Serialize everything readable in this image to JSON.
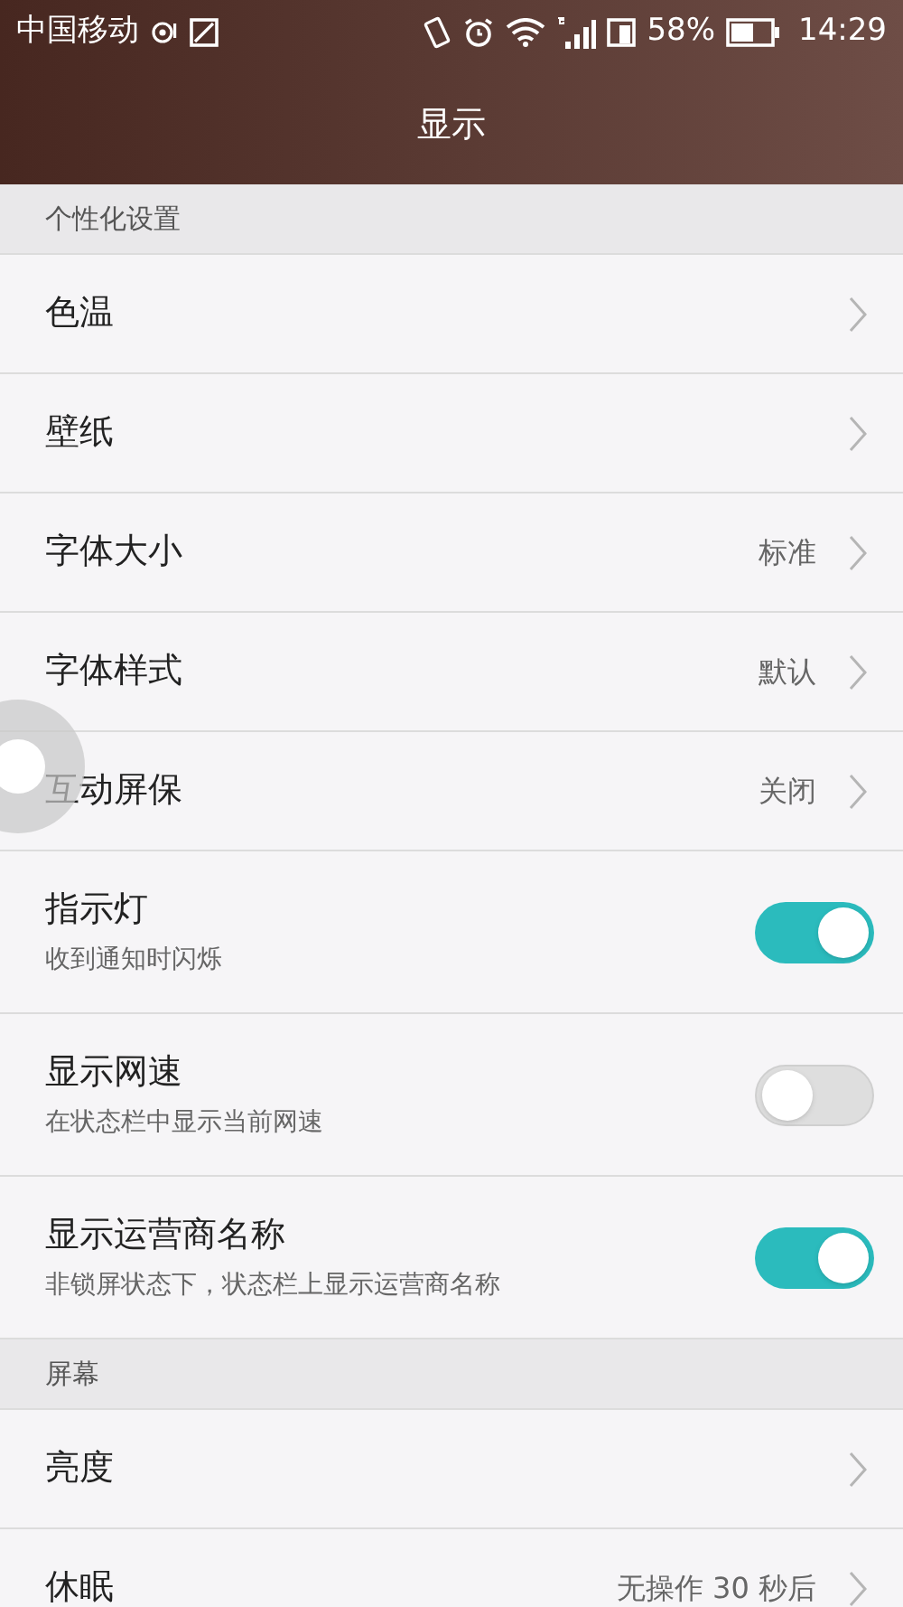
{
  "status_bar": {
    "carrier": "中国移动",
    "battery": "58%",
    "time": "14:29"
  },
  "title": "显示",
  "sections": [
    {
      "header": "个性化设置",
      "items": [
        {
          "kind": "link",
          "label": "色温"
        },
        {
          "kind": "link",
          "label": "壁纸"
        },
        {
          "kind": "link",
          "label": "字体大小",
          "value": "标准"
        },
        {
          "kind": "link",
          "label": "字体样式",
          "value": "默认"
        },
        {
          "kind": "link",
          "label": "互动屏保",
          "value": "关闭"
        },
        {
          "kind": "toggle",
          "label": "指示灯",
          "subtitle": "收到通知时闪烁",
          "on": true
        },
        {
          "kind": "toggle",
          "label": "显示网速",
          "subtitle": "在状态栏中显示当前网速",
          "on": false
        },
        {
          "kind": "toggle",
          "label": "显示运营商名称",
          "subtitle": "非锁屏状态下，状态栏上显示运营商名称",
          "on": true
        }
      ]
    },
    {
      "header": "屏幕",
      "items": [
        {
          "kind": "link",
          "label": "亮度"
        },
        {
          "kind": "link",
          "label": "休眠",
          "value": "无操作 30 秒后"
        }
      ]
    }
  ]
}
